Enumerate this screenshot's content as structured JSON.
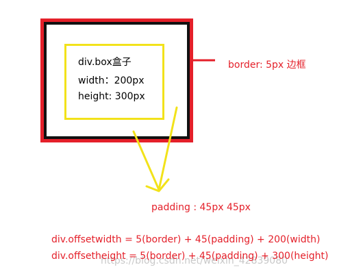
{
  "box": {
    "line1": "div.box盒子",
    "line2": "width：200px",
    "line3": "height: 300px"
  },
  "border_label": "border: 5px 边框",
  "padding_label": "padding : 45px 45px",
  "formulas": {
    "width": "div.offsetwidth = 5(border) + 45(padding) + 200(width)",
    "height": "div.offsetheight = 5(border) + 45(padding) + 300(height)"
  },
  "watermark": "https://blog.csdn.net/weixin_42839080",
  "colors": {
    "border": "#e4202a",
    "inner_border": "#111111",
    "content_outline": "#f2e21a",
    "arrow": "#f2e21a",
    "text_red": "#e4202a"
  }
}
